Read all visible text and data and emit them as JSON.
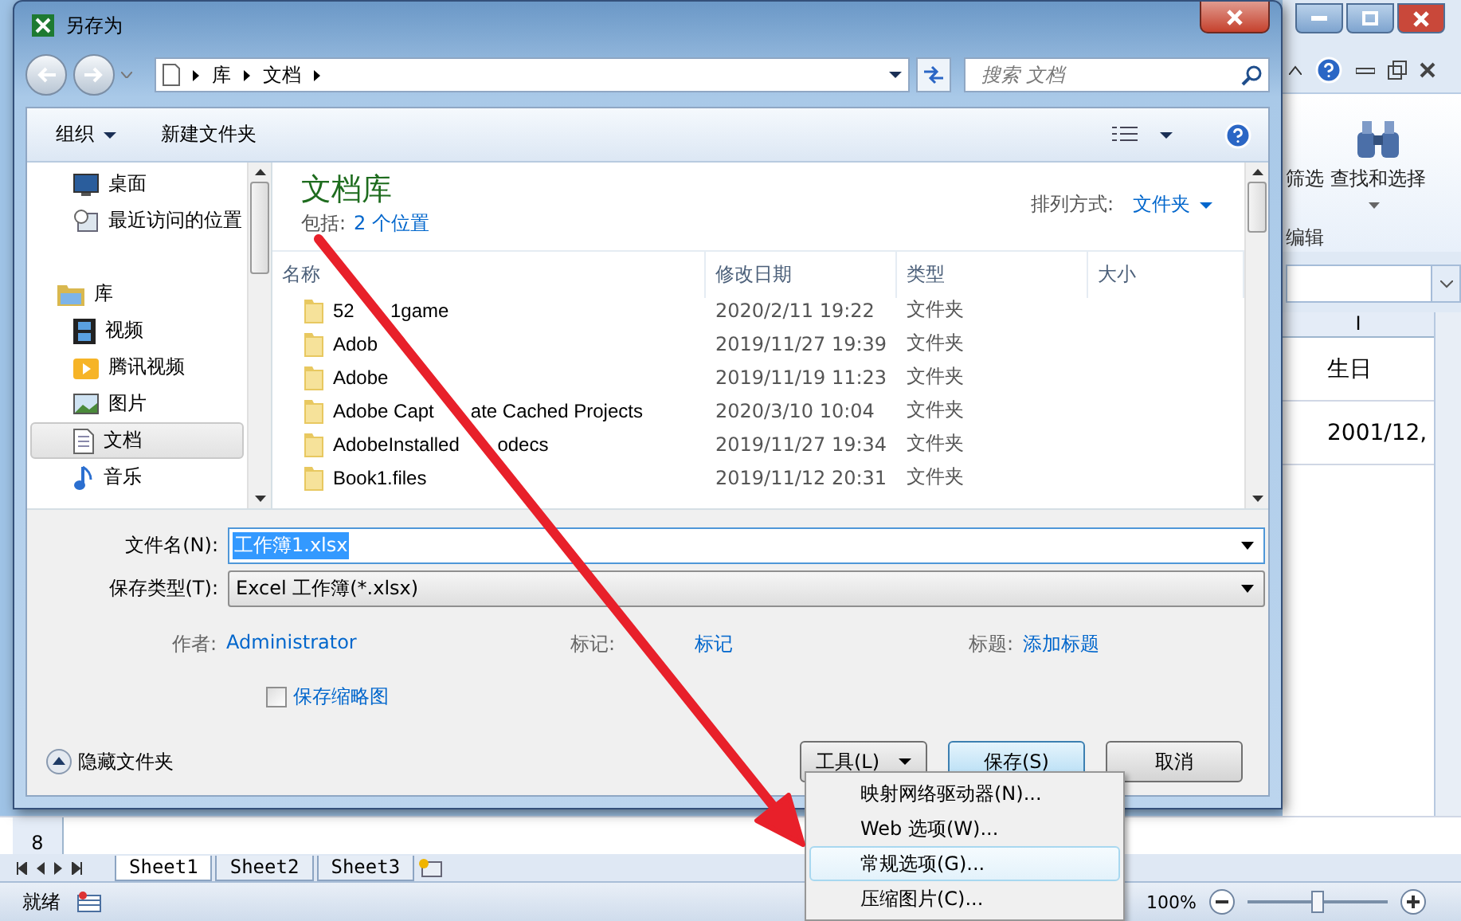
{
  "excel": {
    "ribbon": {
      "buttons": [
        "筛选",
        "查找和选择"
      ],
      "group_label": "编辑"
    },
    "column_header": "I",
    "cells": [
      "生日",
      "2001/12,"
    ],
    "row_header": "8",
    "sheet_tabs": [
      {
        "label": "Sheet1",
        "selected": true
      },
      {
        "label": "Sheet2",
        "selected": false
      },
      {
        "label": "Sheet3",
        "selected": false
      }
    ],
    "status": "就绪",
    "zoom": "100%",
    "zoom_slider": {
      "level": 0.5
    }
  },
  "dialog": {
    "title": "另存为",
    "breadcrumb": [
      "库",
      "文档"
    ],
    "search": {
      "placeholder": "搜索 文档"
    },
    "toolbar": [
      "组织",
      "新建文件夹"
    ],
    "favorites": [
      {
        "label": "桌面",
        "kind": "desktop",
        "selected": false
      },
      {
        "label": "最近访问的位置",
        "kind": "recent",
        "selected": false
      }
    ],
    "library": {
      "label": "库",
      "children": [
        {
          "label": "视频",
          "kind": "video",
          "selected": false
        },
        {
          "label": "腾讯视频",
          "kind": "tencent",
          "selected": false
        },
        {
          "label": "图片",
          "kind": "pictures",
          "selected": false
        },
        {
          "label": "文档",
          "kind": "documents",
          "selected": true
        },
        {
          "label": "音乐",
          "kind": "music",
          "selected": false
        }
      ]
    },
    "header": {
      "title": "文档库",
      "includes_label": "包括:",
      "includes_link": "2 个位置",
      "sort_label": "排列方式:",
      "sort_value": "文件夹"
    },
    "columns": [
      "名称",
      "修改日期",
      "类型",
      "大小"
    ],
    "files": [
      {
        "name": [
          "52",
          "1game"
        ],
        "date": "2020/2/11 19:22",
        "type": "文件夹"
      },
      {
        "name": "Adob",
        "date": "2019/11/27 19:39",
        "type": "文件夹"
      },
      {
        "name": "Adobe",
        "date": "2019/11/19 11:23",
        "type": "文件夹"
      },
      {
        "name": [
          "Adobe Capt",
          "ate Cached Projects"
        ],
        "date": "2020/3/10 10:04",
        "type": "文件夹"
      },
      {
        "name": [
          "AdobeInstalled",
          "odecs"
        ],
        "date": "2019/11/27 19:34",
        "type": "文件夹"
      },
      {
        "name": "Book1.files",
        "date": "2019/11/12 20:31",
        "type": "文件夹"
      }
    ],
    "file_name": {
      "label": "文件名(N):",
      "value": "工作簿1.xlsx"
    },
    "file_type": {
      "label": "保存类型(T):",
      "value": "Excel 工作簿(*.xlsx)"
    },
    "meta": [
      {
        "label": "作者:",
        "value": "Administrator"
      },
      {
        "label": "标记:",
        "value": "标记"
      },
      {
        "label": "标题:",
        "value": "添加标题"
      }
    ],
    "thumbnail": {
      "label": "保存缩略图",
      "checked": false
    },
    "hide_folders": "隐藏文件夹",
    "tools": "工具(L)",
    "save": "保存(S)",
    "cancel": "取消",
    "tools_menu": [
      {
        "label": "映射网络驱动器(N)...",
        "selected": false
      },
      {
        "label": "Web 选项(W)...",
        "selected": false
      },
      {
        "label": "常规选项(G)...",
        "selected": true
      },
      {
        "label": "压缩图片(C)...",
        "selected": false
      }
    ]
  }
}
